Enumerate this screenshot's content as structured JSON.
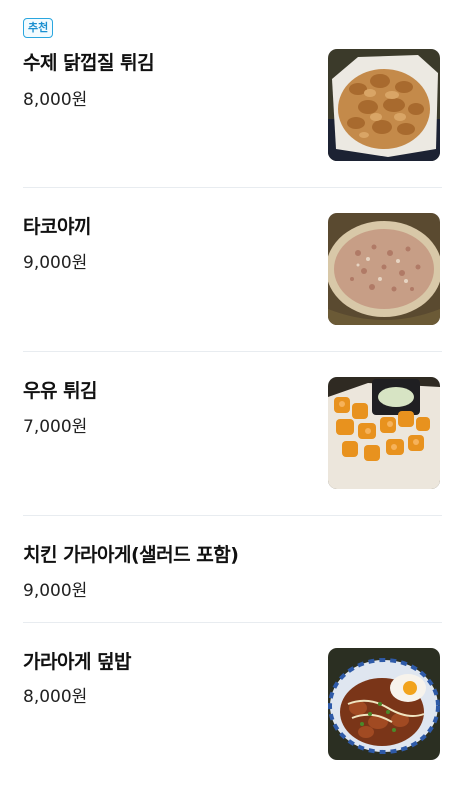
{
  "menu": {
    "items": [
      {
        "badge": "추천",
        "name": "수제 닭껍질 튀김",
        "price": "8,000원",
        "image": "fried-chicken-skin-photo"
      },
      {
        "name": "타코야끼",
        "price": "9,000원",
        "image": "takoyaki-photo"
      },
      {
        "name": "우유 튀김",
        "price": "7,000원",
        "image": "fried-milk-photo"
      },
      {
        "name": "치킨 가라아게(샐러드 포함)",
        "price": "9,000원"
      },
      {
        "name": "가라아게 덮밥",
        "price": "8,000원",
        "image": "karaage-rice-bowl-photo"
      }
    ]
  },
  "colors": {
    "badge_border": "#2aa6df",
    "badge_text": "#1a8fd0",
    "divider": "#e8ecf0"
  }
}
